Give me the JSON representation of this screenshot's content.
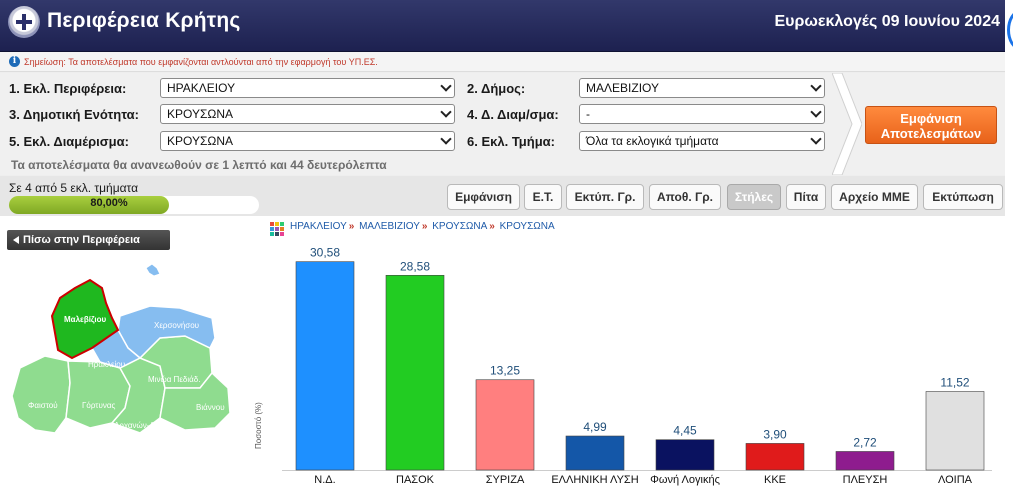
{
  "header": {
    "title": "Περιφέρεια Κρήτης",
    "election": "Ευρωεκλογές 09 Ιουνίου 2024"
  },
  "notice": "Σημείωση: Τα αποτελέσματα που εμφανίζονται αντλούνται από την εφαρμογή του ΥΠ.ΕΣ.",
  "filters": {
    "f1_label": "1. Εκλ. Περιφέρεια:",
    "f1_value": "ΗΡΑΚΛΕΙΟΥ",
    "f2_label": "2. Δήμος:",
    "f2_value": "ΜΑΛΕΒΙΖΙΟΥ",
    "f3_label": "3. Δημοτική Ενότητα:",
    "f3_value": "ΚΡΟΥΣΩΝΑ",
    "f4_label": "4. Δ. Διαμ/σμα:",
    "f4_value": "-",
    "f5_label": "5. Εκλ. Διαμέρισμα:",
    "f5_value": "ΚΡΟΥΣΩΝΑ",
    "f6_label": "6. Εκλ. Τμήμα:",
    "f6_value": "Όλα τα εκλογικά τμήματα",
    "refresh": "Τα αποτελέσματα θα ανανεωθούν σε 1 λεπτό και 44 δευτερόλεπτα",
    "show_button_line1": "Εμφάνιση",
    "show_button_line2": "Αποτελεσμάτων"
  },
  "progress": {
    "text": "Σε 4 από 5 εκλ. τμήματα",
    "label": "80,00%",
    "fraction": 0.8
  },
  "tabs": [
    "Εμφάνιση",
    "Ε.Τ.",
    "Εκτύπ. Γρ.",
    "Αποθ. Γρ.",
    "Στήλες",
    "Πίτα",
    "Αρχείο ΜΜΕ",
    "Εκτύπωση"
  ],
  "active_tab": "Στήλες",
  "back_button": "Πίσω στην Περιφέρεια",
  "breadcrumb": [
    "ΗΡΑΚΛΕΙΟΥ",
    "ΜΑΛΕΒΙΖΙΟΥ",
    "ΚΡΟΥΣΩΝΑ",
    "ΚΡΟΥΣΩΝΑ"
  ],
  "map": {
    "labels": [
      "Μαλεβίζιου",
      "Χερσονήσου",
      "Ηρακλείου",
      "Μινώα Πεδιάδ.",
      "Φαιστού",
      "Γόρτυνας",
      "Βιάννου",
      "Αρχανών-Α"
    ],
    "colors": {
      "selected": "#1fb81f",
      "highlight": "#86bdf0",
      "base": "#8fdc8f"
    }
  },
  "chart_data": {
    "type": "bar",
    "ylabel": "Ποσοστό (%)",
    "categories": [
      "Ν.Δ.",
      "ΠΑΣΟΚ",
      "ΣΥΡΙΖΑ",
      "ΕΛΛΗΝΙΚΗ ΛΥΣΗ",
      "Φωνή Λογικής",
      "ΚΚΕ",
      "ΠΛΕΥΣΗ",
      "ΛΟΙΠΑ"
    ],
    "value_labels": [
      "30,58",
      "28,58",
      "13,25",
      "4,99",
      "4,45",
      "3,90",
      "2,72",
      "11,52"
    ],
    "values": [
      30.58,
      28.58,
      13.25,
      4.99,
      4.45,
      3.9,
      2.72,
      11.52
    ],
    "colors": [
      "#1e90ff",
      "#22cc22",
      "#ff7f7f",
      "#1457a8",
      "#0a1260",
      "#e01b1b",
      "#8e1c8e",
      "#e0e0e0"
    ],
    "ylim": [
      0,
      32
    ]
  }
}
